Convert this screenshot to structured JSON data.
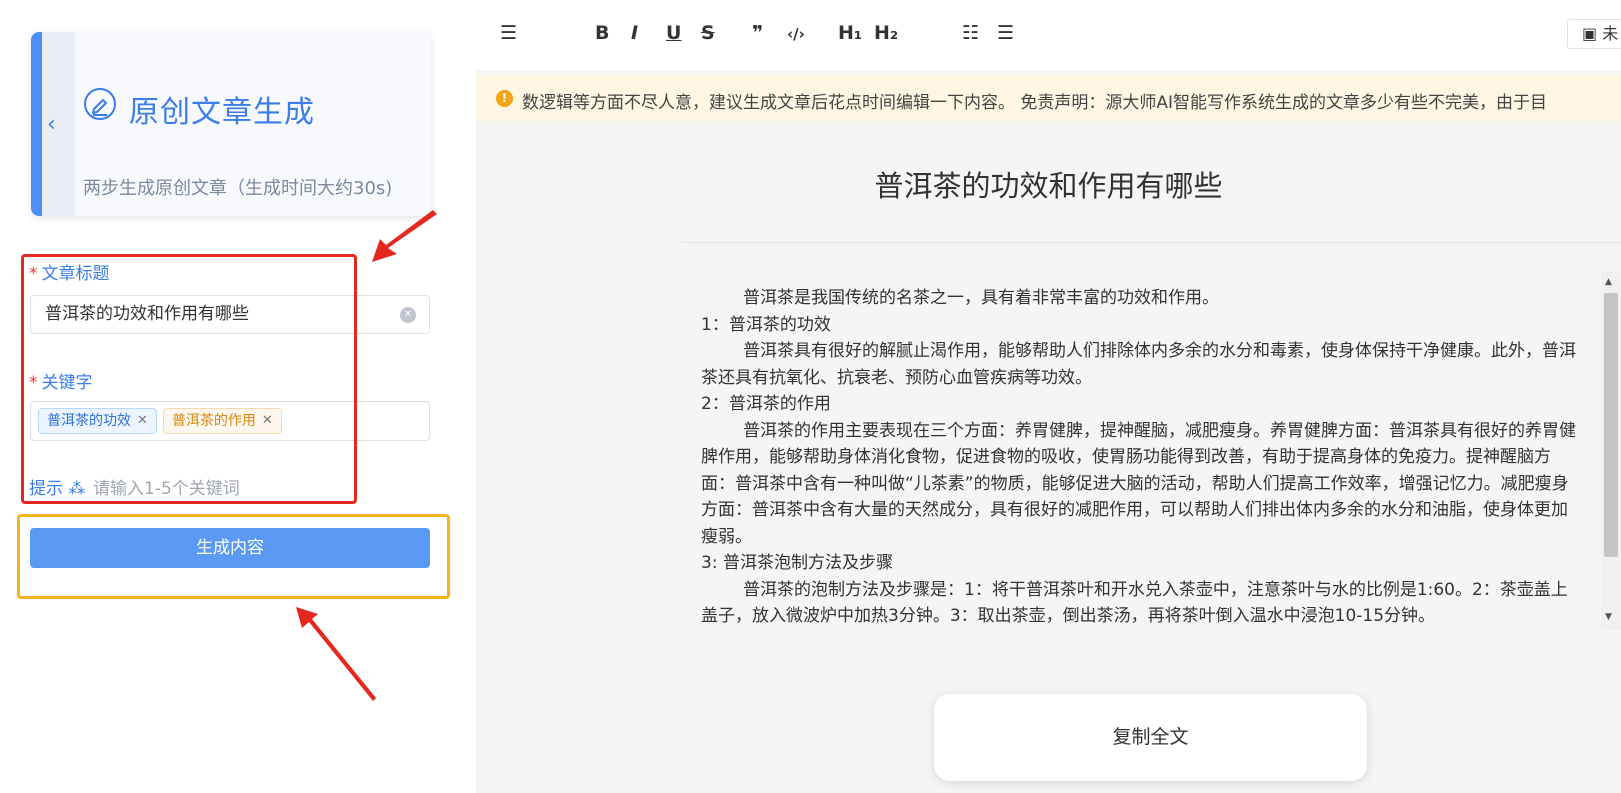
{
  "sidebar": {
    "card_title": "原创文章生成",
    "card_subtitle": "两步生成原创文章（生成时间大约30s)",
    "back_glyph": "‹"
  },
  "form": {
    "required_mark": "*",
    "title_label": "文章标题",
    "title_value": "普洱茶的功效和作用有哪些",
    "keyword_label": "关键字",
    "keywords": [
      "普洱茶的功效",
      "普洱茶的作用"
    ],
    "hint_label": "提示 ⁂",
    "hint_text": "请输入1-5个关键词",
    "generate_label": "生成内容"
  },
  "toolbar": {
    "items": [
      "B",
      "I",
      "U",
      "S",
      "❞",
      "‹/›",
      "H₁",
      "H₂"
    ],
    "save_label": "未"
  },
  "notice": {
    "text": "数逻辑等方面不尽人意，建议生成文章后花点时间编辑一下内容。        免责声明：源大师AI智能写作系统生成的文章多少有些不完美，由于目"
  },
  "article": {
    "title": "普洱茶的功效和作用有哪些",
    "paragraphs": [
      {
        "text": "普洱茶是我国传统的名茶之一，具有着非常丰富的功效和作用。",
        "indent": true
      },
      {
        "text": "1：普洱茶的功效",
        "indent": false
      },
      {
        "text": "普洱茶具有很好的解腻止渴作用，能够帮助人们排除体内多余的水分和毒素，使身体保持干净健康。此外，普洱茶还具有抗氧化、抗衰老、预防心血管疾病等功效。",
        "indent": true
      },
      {
        "text": "2：普洱茶的作用",
        "indent": false
      },
      {
        "text": "普洱茶的作用主要表现在三个方面：养胃健脾，提神醒脑，减肥瘦身。养胃健脾方面：普洱茶具有很好的养胃健脾作用，能够帮助身体消化食物，促进食物的吸收，使胃肠功能得到改善，有助于提高身体的免疫力。提神醒脑方面：普洱茶中含有一种叫做“儿茶素”的物质，能够促进大脑的活动，帮助人们提高工作效率，增强记忆力。减肥瘦身方面：普洱茶中含有大量的天然成分，具有很好的减肥作用，可以帮助人们排出体内多余的水分和油脂，使身体更加瘦弱。",
        "indent": true
      },
      {
        "text": "3: 普洱茶泡制方法及步骤",
        "indent": false
      },
      {
        "text": "普洱茶的泡制方法及步骤是：1：将干普洱茶叶和开水兑入茶壶中，注意茶叶与水的比例是1:60。2：茶壶盖上盖子，放入微波炉中加热3分钟。3：取出茶壶，倒出茶汤，再将茶叶倒入温水中浸泡10-15分钟。",
        "indent": true
      }
    ],
    "copy_label": "复制全文"
  },
  "colors": {
    "accent": "#3b7de9",
    "button": "#5a9af5",
    "annotation_red": "#e5281f",
    "annotation_yellow": "#f7b31b"
  }
}
